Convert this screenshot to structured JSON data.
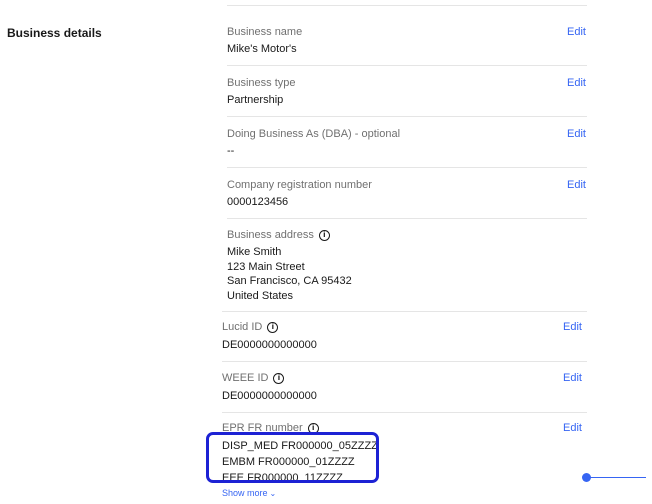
{
  "section": {
    "title": "Business details"
  },
  "fields": [
    {
      "label": "Business name",
      "value": "Mike's Motor's",
      "edit": "Edit"
    },
    {
      "label": "Business type",
      "value": "Partnership",
      "edit": "Edit"
    },
    {
      "label": "Doing Business As (DBA) - optional",
      "value": "--",
      "edit": "Edit"
    },
    {
      "label": "Company registration number",
      "value": "0000123456",
      "edit": "Edit"
    },
    {
      "label": "Business address",
      "address": [
        "Mike Smith",
        "123 Main Street",
        "San Francisco, CA 95432",
        "United States"
      ]
    },
    {
      "label": "Lucid ID",
      "value": "DE0000000000000",
      "edit": "Edit"
    },
    {
      "label": "WEEE ID",
      "value": "DE0000000000000",
      "edit": "Edit"
    },
    {
      "label": "EPR FR number",
      "values": [
        "DISP_MED FR000000_05ZZZZ",
        "EMBM FR000000_01ZZZZ",
        "EEE FR000000_11ZZZZ"
      ],
      "edit": "Edit"
    }
  ],
  "show_more": "Show more",
  "colors": {
    "link": "#3665f3",
    "highlight": "#1d22d4",
    "divider": "#e5e5e5",
    "label": "#707070"
  },
  "icons": {
    "info": "info-icon",
    "chevron": "chevron-down-icon"
  }
}
